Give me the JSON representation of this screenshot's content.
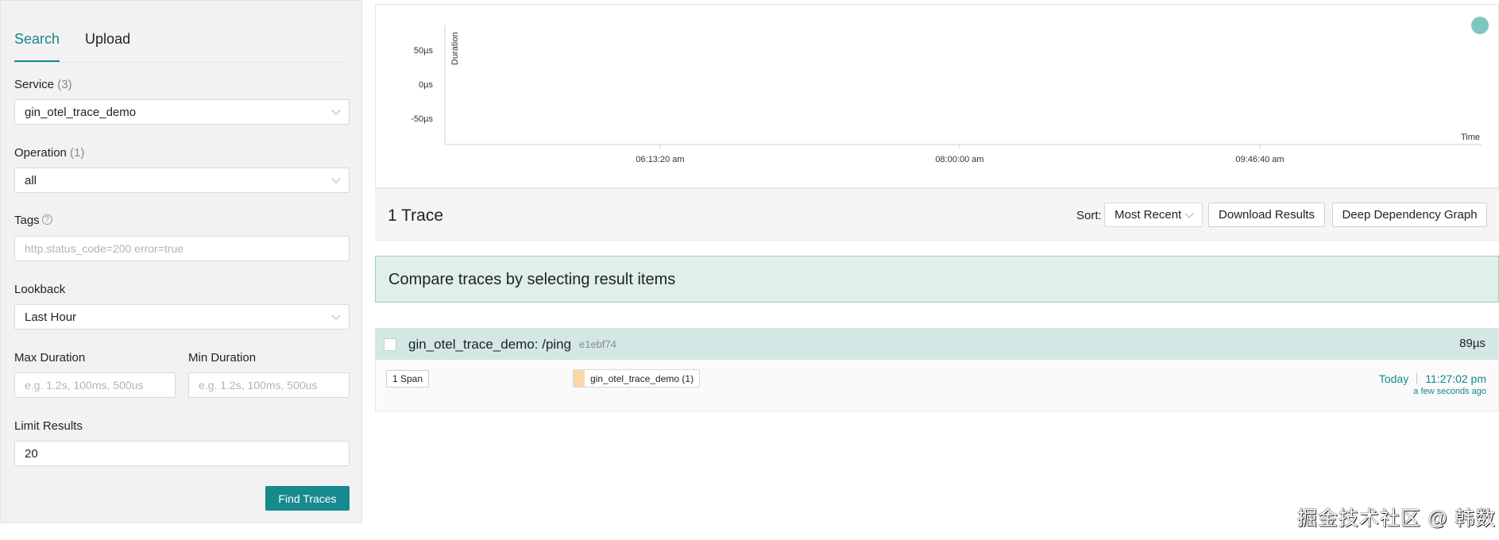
{
  "tabs": [
    {
      "label": "Search"
    },
    {
      "label": "Upload"
    }
  ],
  "form": {
    "service_label": "Service",
    "service_count": "(3)",
    "service_value": "gin_otel_trace_demo",
    "operation_label": "Operation",
    "operation_count": "(1)",
    "operation_value": "all",
    "tags_label": "Tags",
    "tags_placeholder": "http.status_code=200 error=true",
    "lookback_label": "Lookback",
    "lookback_value": "Last Hour",
    "max_duration_label": "Max Duration",
    "max_duration_placeholder": "e.g. 1.2s, 100ms, 500us",
    "min_duration_label": "Min Duration",
    "min_duration_placeholder": "e.g. 1.2s, 100ms, 500us",
    "limit_label": "Limit Results",
    "limit_value": "20",
    "find_button": "Find Traces"
  },
  "chart_data": {
    "type": "scatter",
    "ylabel": "Duration",
    "xlabel": "Time",
    "y_ticks": [
      "50µs",
      "0µs",
      "-50µs"
    ],
    "x_ticks": [
      "06:13:20 am",
      "08:00:00 am",
      "09:46:40 am"
    ],
    "points": [
      {
        "x": "11:27:02 pm",
        "y_us": 89
      }
    ],
    "point_color": "#7fc6c3"
  },
  "results": {
    "count_label": "1 Trace",
    "sort_label": "Sort:",
    "sort_value": "Most Recent",
    "download_button": "Download Results",
    "ddg_button": "Deep Dependency Graph",
    "compare_text": "Compare traces by selecting result items"
  },
  "trace": {
    "name": "gin_otel_trace_demo: /ping",
    "id": "e1ebf74",
    "duration": "89µs",
    "span_count": "1 Span",
    "service_tag": "gin_otel_trace_demo (1)",
    "day": "Today",
    "time": "11:27:02 pm",
    "relative": "a few seconds ago"
  },
  "watermark": "掘金技术社区 @ 韩数"
}
